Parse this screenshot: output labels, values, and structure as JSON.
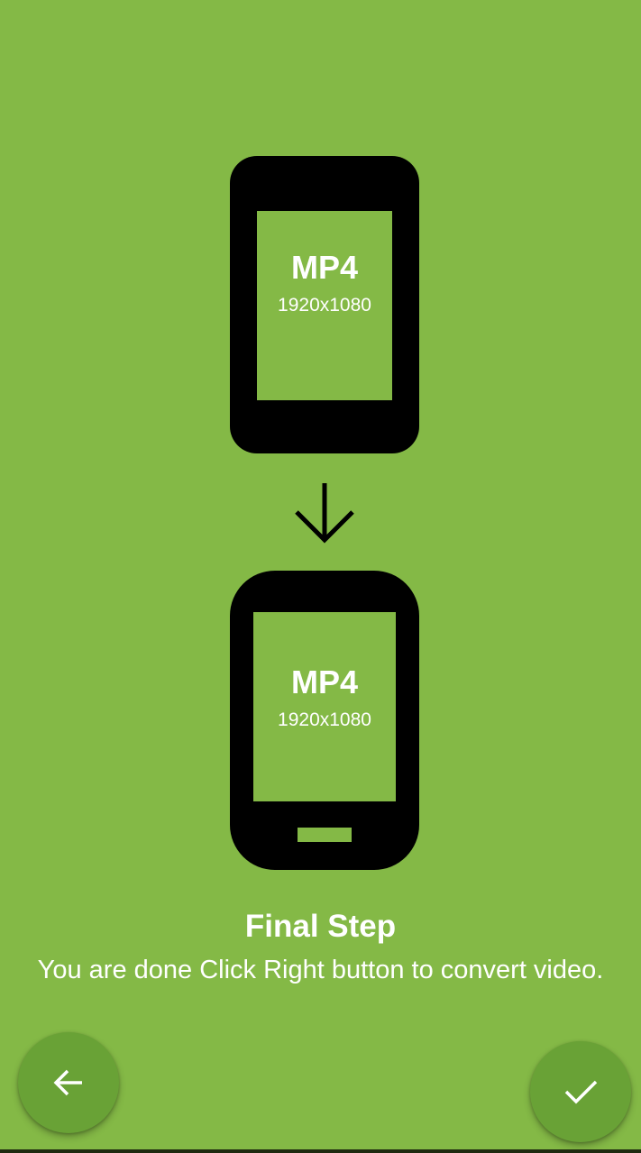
{
  "source_device": {
    "format": "MP4",
    "resolution": "1920x1080"
  },
  "target_device": {
    "format": "MP4",
    "resolution": "1920x1080"
  },
  "step": {
    "title": "Final Step",
    "description": "You are done Click Right button to convert video."
  },
  "icons": {
    "arrow": "arrow-down-icon",
    "back": "arrow-back-icon",
    "done": "check-icon"
  },
  "colors": {
    "background": "#84b946",
    "fab": "#69a236",
    "phone": "#000000",
    "text": "#ffffff"
  }
}
